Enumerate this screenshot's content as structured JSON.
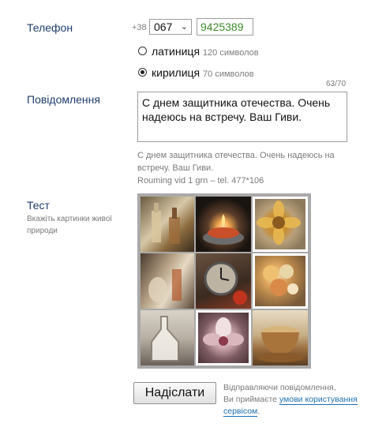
{
  "phone": {
    "label": "Телефон",
    "country_code": "+38",
    "operator_code": "067",
    "number": "9425389"
  },
  "encoding": {
    "latin_label": "латиниця",
    "latin_limit": "120 символов",
    "cyr_label": "кирилиця",
    "cyr_limit": "70 символов",
    "selected": "кирилиця",
    "counter": "63/70"
  },
  "message": {
    "label": "Повідомлення",
    "text": "С днем защитника отечества. Очень надеюсь на встречу. Ваш Гиви.",
    "preview": "С днем защитника отечества. Очень надеюсь на встречу. Ваш Гиви.",
    "preview_footer": "Rouming vid 1 grn – tel. 477*106"
  },
  "captcha": {
    "label": "Тест",
    "hint": "Вкажіть картинки живої природи"
  },
  "submit": {
    "button_label": "Надіслати",
    "notice_line1": "Відправляючи повідомлення,",
    "notice_line2_prefix": "Ви приймаєте ",
    "notice_link": "умови користування сервісом",
    "notice_suffix": "."
  }
}
